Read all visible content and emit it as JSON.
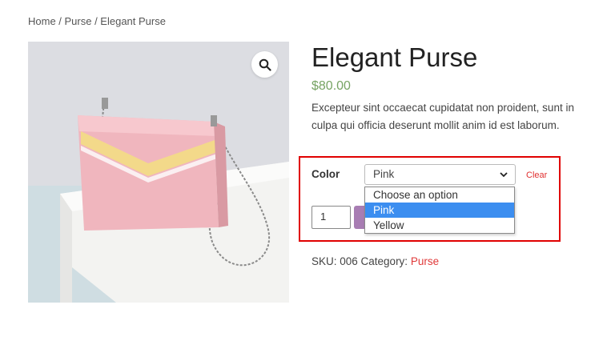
{
  "breadcrumb": {
    "text": "Home / Purse / Elegant Purse"
  },
  "product": {
    "title": "Elegant Purse",
    "price": "$80.00",
    "description": "Excepteur sint occaecat cupidatat non proident, sunt in culpa qui officia deserunt mollit anim id est laborum."
  },
  "variation": {
    "label": "Color",
    "selected": "Pink",
    "clear_label": "Clear",
    "options": [
      "Choose an option",
      "Pink",
      "Yellow"
    ],
    "highlighted_index": 1
  },
  "cart": {
    "quantity": "1"
  },
  "meta": {
    "sku_text": "SKU: 006 Category:",
    "category": "Purse"
  },
  "colors": {
    "price": "#77a464",
    "highlight_box": "#e00000",
    "selected_option": "#3c8ef0",
    "add_button": "#a87db3",
    "link": "#e03a3a"
  },
  "icons": {
    "zoom": "search-icon",
    "select_arrow": "chevron-down-icon"
  }
}
